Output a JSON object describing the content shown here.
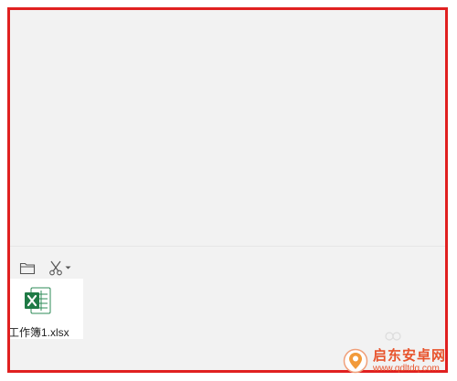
{
  "toolbar": {
    "folder_icon": "folder-icon",
    "scissors_icon": "scissors-icon",
    "dropdown_icon": "chevron-down-icon"
  },
  "attachment": {
    "icon": "excel-file-icon",
    "file_name": "工作簿1.xlsx"
  },
  "watermark": {
    "title": "启东安卓网",
    "url": "www.qdltdq.com"
  },
  "colors": {
    "frame_border": "#e02020",
    "excel_green": "#1f7a45",
    "brand_orange": "#e8532c"
  }
}
